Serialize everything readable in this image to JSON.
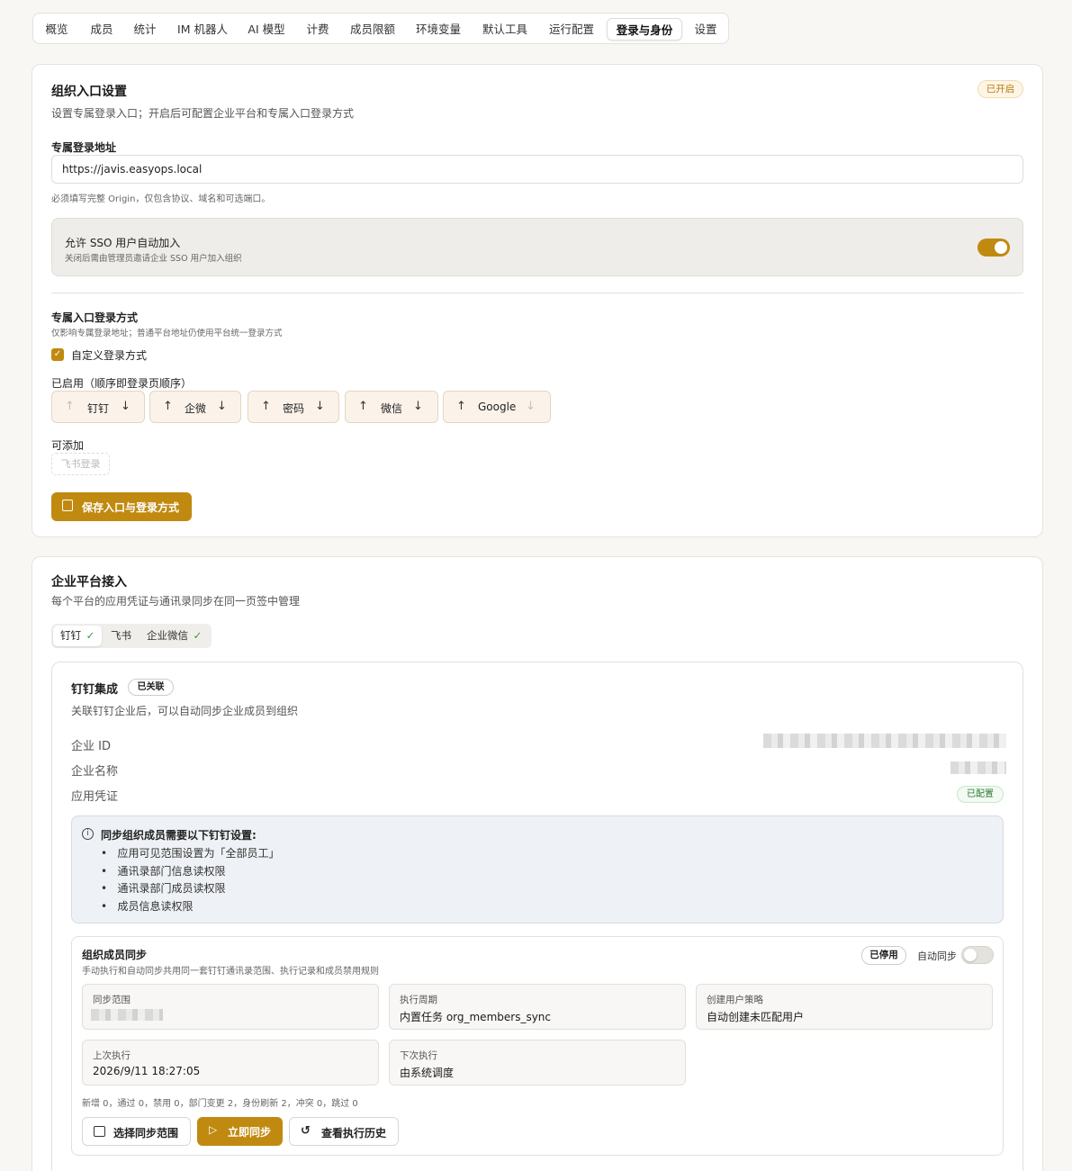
{
  "tabs": [
    "概览",
    "成员",
    "统计",
    "IM 机器人",
    "AI 模型",
    "计费",
    "成员限额",
    "环境变量",
    "默认工具",
    "运行配置",
    "登录与身份",
    "设置"
  ],
  "active_tab": "登录与身份",
  "org_entry": {
    "title": "组织入口设置",
    "status_badge": "已开启",
    "description": "设置专属登录入口；开启后可配置企业平台和专属入口登录方式",
    "url_label": "专属登录地址",
    "url_value": "https://javis.easyops.local",
    "url_hint": "必须填写完整 Origin，仅包含协议、域名和可选端口。",
    "sso_title": "允许 SSO 用户自动加入",
    "sso_desc": "关闭后需由管理员邀请企业 SSO 用户加入组织",
    "sso_enabled": true,
    "methods_title": "专属入口登录方式",
    "methods_desc": "仅影响专属登录地址；普通平台地址仍使用平台统一登录方式",
    "custom_label": "自定义登录方式",
    "custom_checked": true,
    "enabled_label": "已启用（顺序即登录页顺序）",
    "enabled_methods": [
      "钉钉",
      "企微",
      "密码",
      "微信",
      "Google"
    ],
    "addable_label": "可添加",
    "addable_methods": [
      "飞书登录"
    ],
    "save_label": "保存入口与登录方式"
  },
  "enterprise": {
    "title": "企业平台接入",
    "description": "每个平台的应用凭证与通讯录同步在同一页签中管理",
    "platform_tabs": [
      {
        "label": "钉钉",
        "check": "✓"
      },
      {
        "label": "飞书",
        "check": ""
      },
      {
        "label": "企业微信",
        "check": "✓"
      }
    ],
    "dingtalk": {
      "title": "钉钉集成",
      "linked_badge": "已关联",
      "description": "关联钉钉企业后，可以自动同步企业成员到组织",
      "corp_id_label": "企业 ID",
      "corp_name_label": "企业名称",
      "credential_label": "应用凭证",
      "credential_badge": "已配置",
      "info_title": "同步组织成员需要以下钉钉设置:",
      "info_items": [
        "应用可见范围设置为「全部员工」",
        "通讯录部门信息读权限",
        "通讯录部门成员读权限",
        "成员信息读权限"
      ]
    },
    "sync": {
      "title": "组织成员同步",
      "description": "手动执行和自动同步共用同一套钉钉通讯录范围、执行记录和成员禁用规则",
      "status_badge": "已停用",
      "auto_label": "自动同步",
      "auto_enabled": false,
      "scope_label": "同步范围",
      "period_label": "执行周期",
      "period_value": "内置任务 org_members_sync",
      "policy_label": "创建用户策略",
      "policy_value": "自动创建未匹配用户",
      "last_label": "上次执行",
      "last_value": "2026/9/11 18:27:05",
      "next_label": "下次执行",
      "next_value": "由系统调度",
      "stats": "新增 0，通过 0，禁用 0，部门变更 2，身份刷新 2，冲突 0，跳过 0",
      "btn_scope": "选择同步范围",
      "btn_sync": "立即同步",
      "btn_history": "查看执行历史"
    }
  },
  "colors": {
    "accent": "#c08a10",
    "accent_badge_bg": "#fdf5e6",
    "ok_green": "#2f7a32",
    "bg": "#f8f7f4"
  }
}
